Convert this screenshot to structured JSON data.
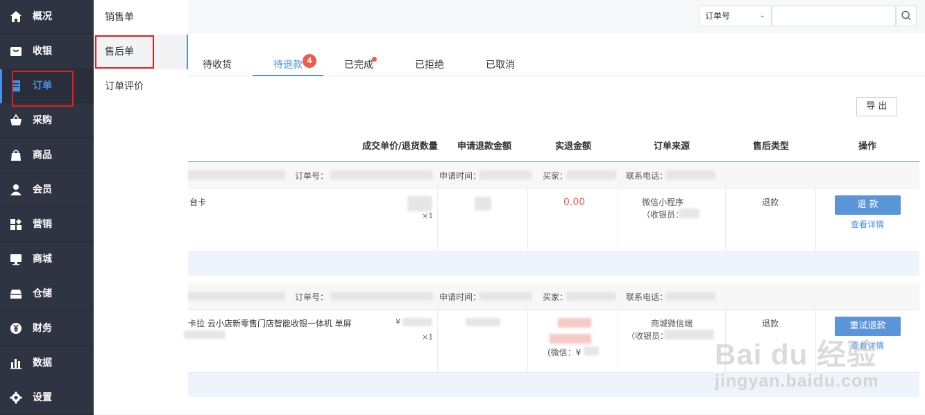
{
  "sidebar": {
    "items": [
      {
        "label": "概况",
        "icon": "home-icon"
      },
      {
        "label": "收银",
        "icon": "cashier-icon"
      },
      {
        "label": "订单",
        "icon": "order-icon"
      },
      {
        "label": "采购",
        "icon": "basket-icon"
      },
      {
        "label": "商品",
        "icon": "bag-icon"
      },
      {
        "label": "会员",
        "icon": "user-icon"
      },
      {
        "label": "营销",
        "icon": "marketing-icon"
      },
      {
        "label": "商城",
        "icon": "monitor-icon"
      },
      {
        "label": "仓储",
        "icon": "storage-icon"
      },
      {
        "label": "财务",
        "icon": "yuan-icon"
      },
      {
        "label": "数据",
        "icon": "bar-chart-icon"
      },
      {
        "label": "设置",
        "icon": "gear-icon"
      }
    ],
    "active": "订单"
  },
  "subnav": {
    "items": [
      "销售单",
      "售后单",
      "订单评价"
    ],
    "active": "售后单"
  },
  "search": {
    "select_value": "订单号",
    "placeholder": ""
  },
  "tabs": [
    {
      "label": "待收货"
    },
    {
      "label": "待退款",
      "badge": "4"
    },
    {
      "label": "已完成"
    },
    {
      "label": "已拒绝"
    },
    {
      "label": "已取消"
    }
  ],
  "export_label": "导 出",
  "table": {
    "headers": [
      "成交单价/退货数量",
      "申请退款金额",
      "实退金额",
      "订单来源",
      "售后类型",
      "操作"
    ],
    "head_labels": {
      "order_no": "订单号：",
      "apply_time": "申请时间：",
      "buyer": "买家：",
      "phone": "联系电话："
    },
    "orders": [
      {
        "product": "台卡",
        "qty": "×1",
        "refund_amount": "0.00",
        "source": "微信小程序",
        "cashier": "（收银员：",
        "type": "退款",
        "action": "退 款",
        "detail": "查看详情"
      },
      {
        "product": "卡拉 云小店新零售门店智能收银一体机 单屏",
        "price_prefix": "¥",
        "qty": "×1",
        "refund_note": "(微信：¥",
        "source": "商城微信端",
        "cashier": "（收银员：",
        "type": "退款",
        "action": "重试退款",
        "detail": "查看详情"
      }
    ]
  },
  "watermark": {
    "brand": "Bai du 经验",
    "url": "jingyan.baidu.com"
  },
  "colors": {
    "sidebar_bg": "#2f3443",
    "accent": "#4a90e2",
    "badge": "#f05b4f",
    "button": "#5b95d9",
    "highlight_box": "#e02020"
  }
}
